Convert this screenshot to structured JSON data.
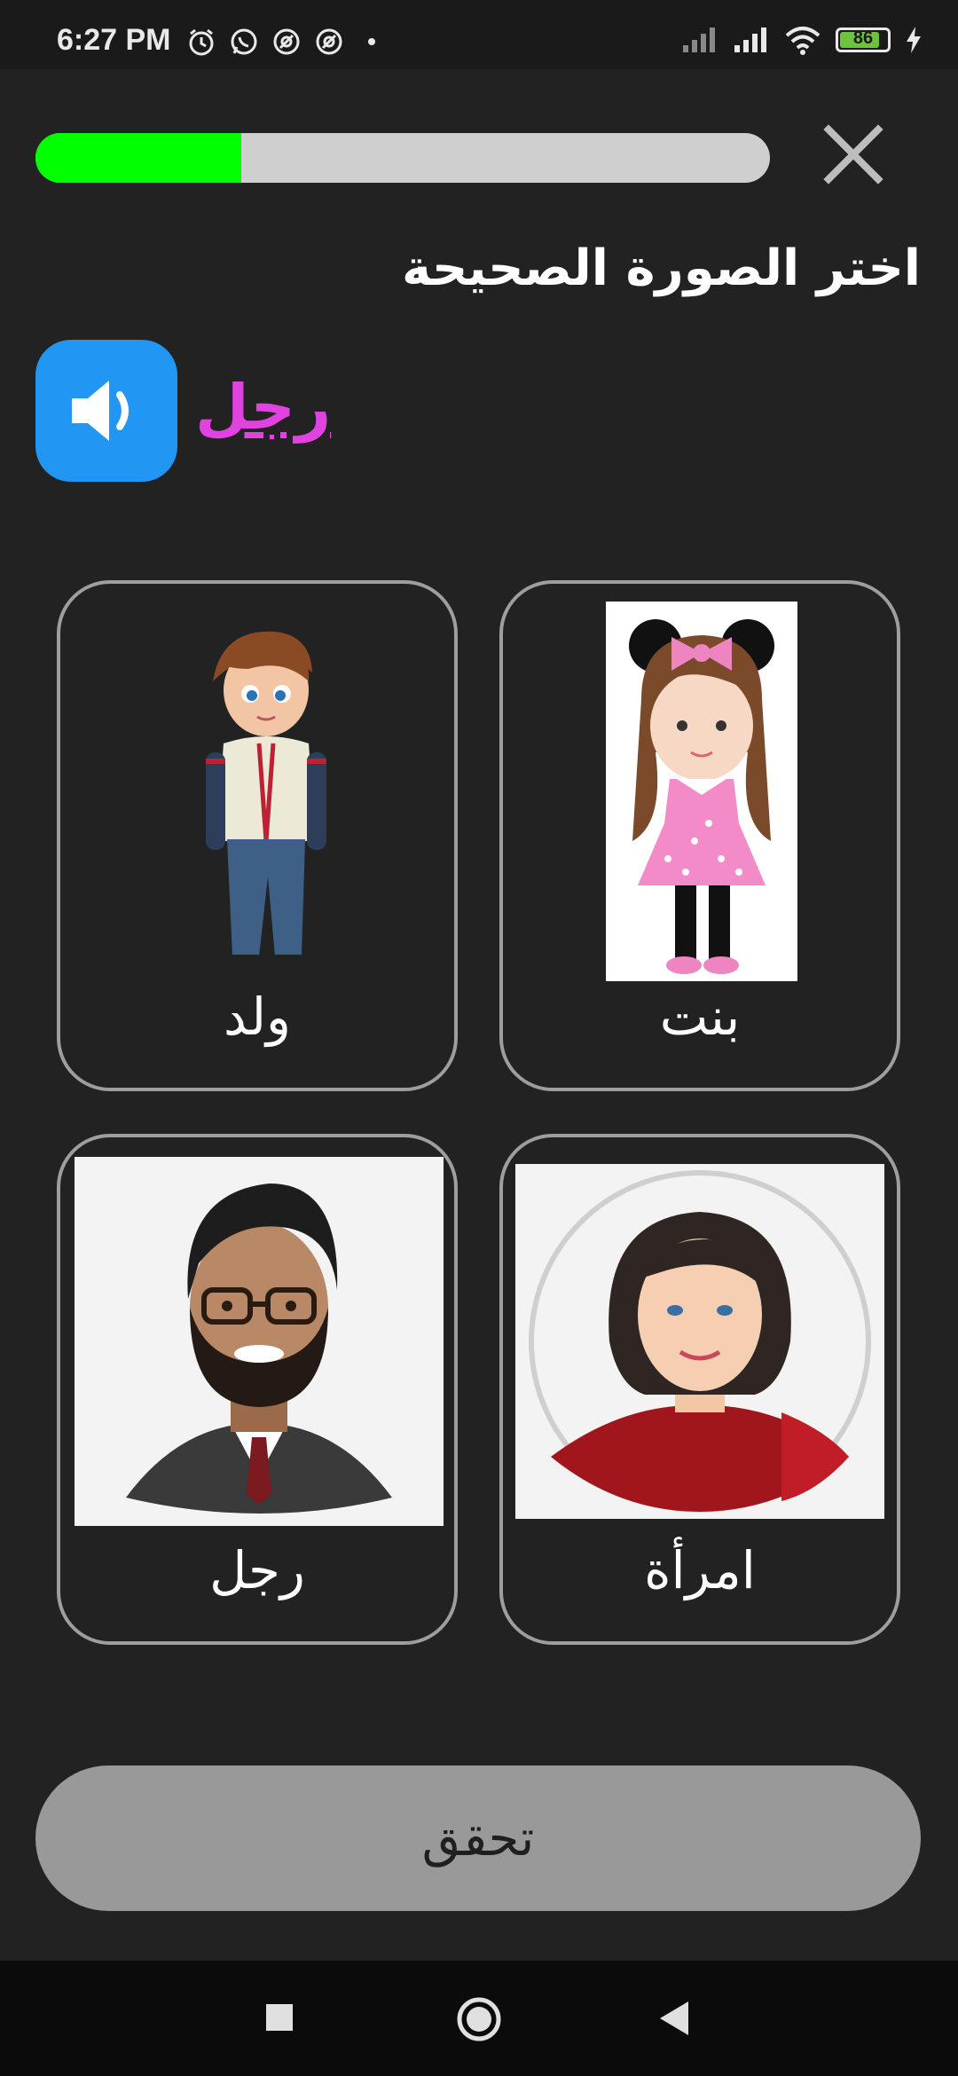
{
  "status_bar": {
    "time": "6:27 PM",
    "battery_level": "86"
  },
  "progress": {
    "fraction": 0.28
  },
  "prompt": "اختر الصورة الصحيحة",
  "target_word": "رجل",
  "options": [
    {
      "label": "ولد",
      "image": "boy-illustration"
    },
    {
      "label": "بنت",
      "image": "girl-illustration"
    },
    {
      "label": "رجل",
      "image": "man-illustration"
    },
    {
      "label": "امرأة",
      "image": "woman-illustration"
    }
  ],
  "check_button_label": "تحقق",
  "colors": {
    "progress": "#00ff00",
    "speaker": "#2196f3",
    "target_word": "#e043e0"
  }
}
